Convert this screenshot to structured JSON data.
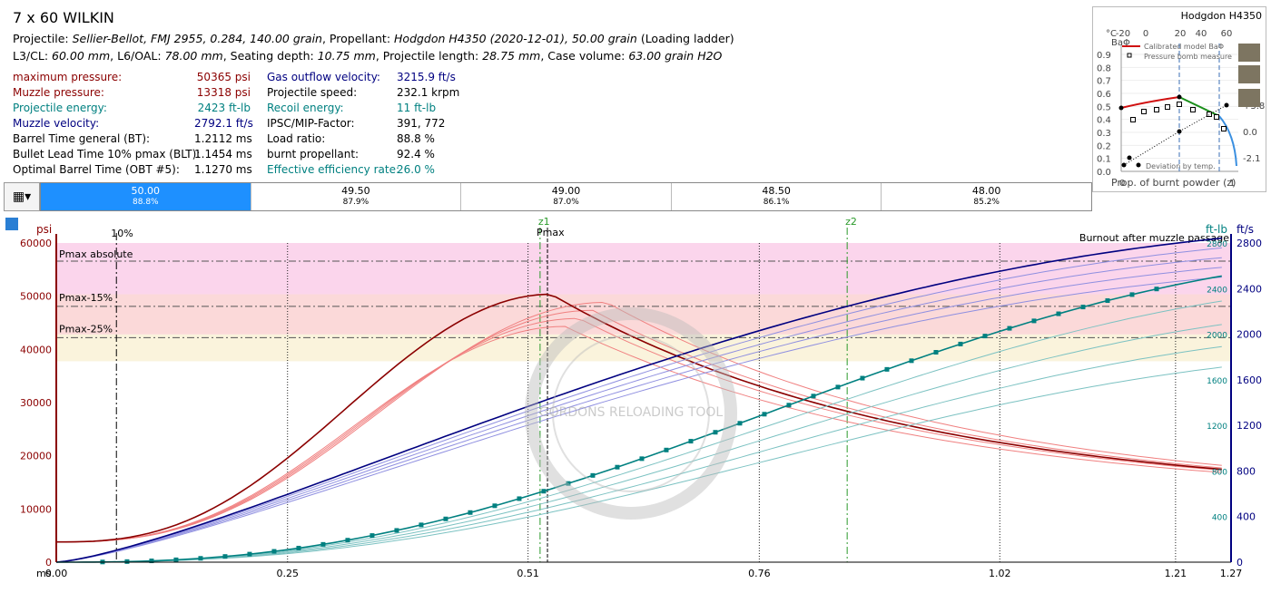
{
  "header": {
    "title": "7 x 60 WILKIN",
    "projectile_label": "Projectile:",
    "projectile_value": "Sellier-Bellot, FMJ 2955, 0.284, 140.00 grain",
    "propellant_label": ", Propellant:",
    "propellant_value": "Hodgdon H4350 (2020-12-01), 50.00 grain",
    "loading_note": "(Loading ladder)",
    "l3_label": "L3/CL:",
    "l3_value": "60.00 mm",
    "l6_label": ", L6/OAL:",
    "l6_value": "78.00 mm",
    "seat_label": ", Seating depth:",
    "seat_value": "10.75 mm",
    "plen_label": ", Projectile length:",
    "plen_value": "28.75 mm",
    "case_label": ", Case volume:",
    "case_value": "63.00 grain H2O"
  },
  "results_left": [
    {
      "label": "maximum pressure:",
      "value": "50365 psi",
      "color": "#8b0000"
    },
    {
      "label": "Muzzle pressure:",
      "value": "13318 psi",
      "color": "#8b0000"
    },
    {
      "label": "Projectile energy:",
      "value": "2423 ft-lb",
      "color": "#008080"
    },
    {
      "label": "Muzzle velocity:",
      "value": "2792.1 ft/s",
      "color": "#000080"
    },
    {
      "label": "Barrel Time general (BT):",
      "value": "1.2112 ms",
      "color": "#000000"
    },
    {
      "label": "Bullet Lead Time 10% pmax (BLT):",
      "value": "1.1454 ms",
      "color": "#000000"
    },
    {
      "label": "Optimal Barrel Time (OBT #5):",
      "value": "1.1270 ms",
      "color": "#000000"
    }
  ],
  "results_right": [
    {
      "label": "Gas outflow velocity:",
      "value": "3215.9 ft/s",
      "color": "#000080"
    },
    {
      "label": "Projectile speed:",
      "value": "232.1 krpm",
      "color": "#000000"
    },
    {
      "label": "Recoil energy:",
      "value": "11 ft-lb",
      "color": "#008080"
    },
    {
      "label": "IPSC/MIP-Factor:",
      "value": "391, 772",
      "color": "#000000"
    },
    {
      "label": "Load ratio:",
      "value": "88.8 %",
      "color": "#000000"
    },
    {
      "label": "burnt propellant:",
      "value": "92.4 %",
      "color": "#000000"
    },
    {
      "label": "Effective efficiency rate:",
      "value": "26.0 %",
      "color": "#008080"
    }
  ],
  "mini_chart": {
    "title": "Hodgdon H4350",
    "y_label": "BaΦ",
    "temp_label": "°C",
    "temp_ticks": [
      "-20",
      "0",
      "20",
      "40",
      "60"
    ],
    "y_ticks": [
      "0.9",
      "0.8",
      "0.7",
      "0.6",
      "0.5",
      "0.4",
      "0.3",
      "0.2",
      "0.1",
      "0.0"
    ],
    "right_ticks": [
      "+3.8",
      "0.0",
      "-2.1"
    ],
    "legend_model": "Calibrated model BaΦ",
    "legend_bomb": "Pressure bomb measure",
    "deviation_label": "Deviation by temp.",
    "x_label": "Prop. of burnt powder (z)",
    "x_ticks": [
      "0",
      "1"
    ]
  },
  "ladder": {
    "menu_icon": "ladder-menu-icon",
    "items": [
      {
        "charge": "50.00",
        "ratio": "88.8%",
        "selected": true
      },
      {
        "charge": "49.50",
        "ratio": "87.9%",
        "selected": false
      },
      {
        "charge": "49.00",
        "ratio": "87.0%",
        "selected": false
      },
      {
        "charge": "48.50",
        "ratio": "86.1%",
        "selected": false
      },
      {
        "charge": "48.00",
        "ratio": "85.2%",
        "selected": false
      }
    ]
  },
  "main_chart": {
    "unit_left": "psi",
    "unit_ftlb": "ft-lb",
    "unit_fts": "ft/s",
    "x_unit": "ms",
    "x_ticks": [
      "0.00",
      "0.25",
      "0.51",
      "0.76",
      "1.02",
      "1.21",
      "1.27"
    ],
    "y_ticks": [
      "60000",
      "50000",
      "40000",
      "30000",
      "20000",
      "10000",
      "0"
    ],
    "ftlb_ticks": [
      "2800",
      "2400",
      "2000",
      "1600",
      "1200",
      "800",
      "400"
    ],
    "fts_ticks": [
      "2800",
      "2400",
      "2000",
      "1600",
      "1200",
      "800",
      "400",
      "0"
    ],
    "label_10pct": "10%",
    "label_z1": "z1",
    "label_pmax": "Pmax",
    "label_z2": "z2",
    "band_pmax_abs": "Pmax absolute",
    "band_pmax15": "Pmax-15%",
    "band_pmax25": "Pmax-25%",
    "burnout_label": "Burnout after muzzle passage",
    "colors": {
      "pressure": "#8b0000",
      "velocity": "#000080",
      "energy": "#008080",
      "z": "#228b22"
    }
  },
  "watermark": "GORDONS RELOADING TOOL"
}
